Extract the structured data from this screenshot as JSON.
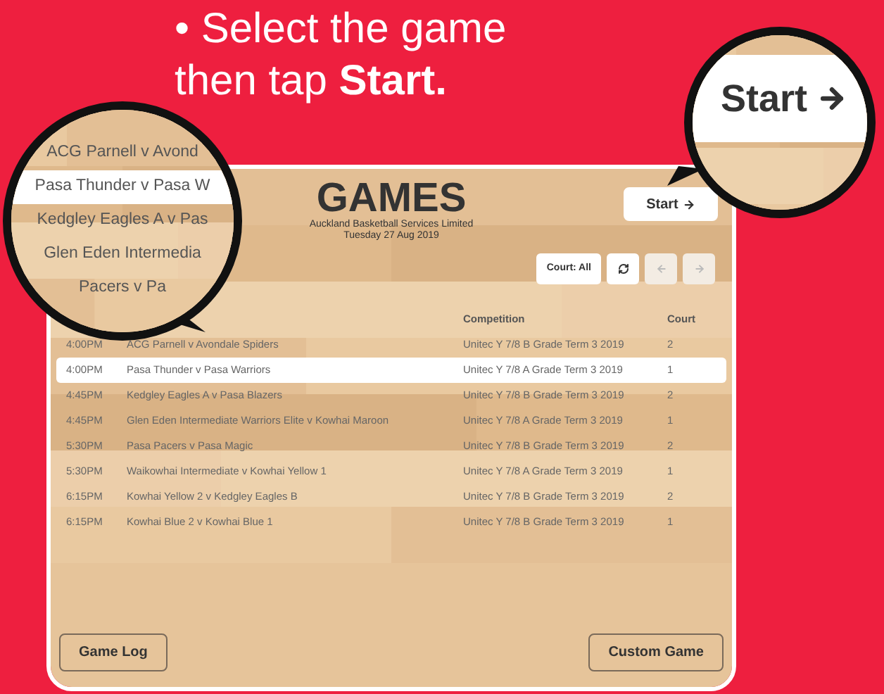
{
  "instruction": {
    "lines": [
      "• Select the game",
      "then tap **Start.**"
    ]
  },
  "app": {
    "title": "GAMES",
    "organization": "Auckland Basketball Services Limited",
    "date": "Tuesday 27 Aug 2019",
    "start_button": {
      "label": "Start"
    },
    "court_filter": {
      "label": "Court: All"
    },
    "nav": [
      {
        "kind": "refresh",
        "disabled": false
      },
      {
        "kind": "prev",
        "disabled": true
      },
      {
        "kind": "next",
        "disabled": true
      }
    ],
    "table": {
      "columns": [
        {
          "label": "Competition"
        },
        {
          "label": "Court"
        }
      ],
      "rows": [
        {
          "time": "4:00PM",
          "game": "ACG Parnell v Avondale Spiders",
          "competition": "Unitec Y 7/8 B Grade Term 3 2019",
          "court": "2",
          "selected": false
        },
        {
          "time": "4:00PM",
          "game": "Pasa Thunder v Pasa Warriors",
          "competition": "Unitec Y 7/8 A Grade Term 3 2019",
          "court": "1",
          "selected": true
        },
        {
          "time": "4:45PM",
          "game": "Kedgley Eagles A v Pasa Blazers",
          "competition": "Unitec Y 7/8 B Grade Term 3 2019",
          "court": "2",
          "selected": false
        },
        {
          "time": "4:45PM",
          "game": "Glen Eden Intermediate Warriors Elite v Kowhai Maroon",
          "competition": "Unitec Y 7/8 A Grade Term 3 2019",
          "court": "1",
          "selected": false
        },
        {
          "time": "5:30PM",
          "game": "Pasa Pacers v Pasa Magic",
          "competition": "Unitec Y 7/8 B Grade Term 3 2019",
          "court": "2",
          "selected": false
        },
        {
          "time": "5:30PM",
          "game": "Waikowhai Intermediate v Kowhai Yellow 1",
          "competition": "Unitec Y 7/8 A Grade Term 3 2019",
          "court": "1",
          "selected": false
        },
        {
          "time": "6:15PM",
          "game": "Kowhai Yellow 2 v Kedgley Eagles B",
          "competition": "Unitec Y 7/8 B Grade Term 3 2019",
          "court": "2",
          "selected": false
        },
        {
          "time": "6:15PM",
          "game": "Kowhai Blue 2 v Kowhai Blue 1",
          "competition": "Unitec Y 7/8 B Grade Term 3 2019",
          "court": "1",
          "selected": false
        }
      ]
    },
    "footer_buttons": [
      {
        "label": "Game Log"
      },
      {
        "label": "Custom Game"
      }
    ]
  },
  "magnifier_left": {
    "rows": [
      {
        "text": "ACG Parnell v Avond",
        "selected": false
      },
      {
        "text": "Pasa Thunder v Pasa W",
        "selected": true
      },
      {
        "text": "Kedgley Eagles A v Pas",
        "selected": false
      },
      {
        "text": "Glen Eden Intermedia",
        "selected": false
      },
      {
        "text": "Pacers v Pa",
        "selected": false
      }
    ]
  },
  "magnifier_right": {
    "label": "Start"
  }
}
